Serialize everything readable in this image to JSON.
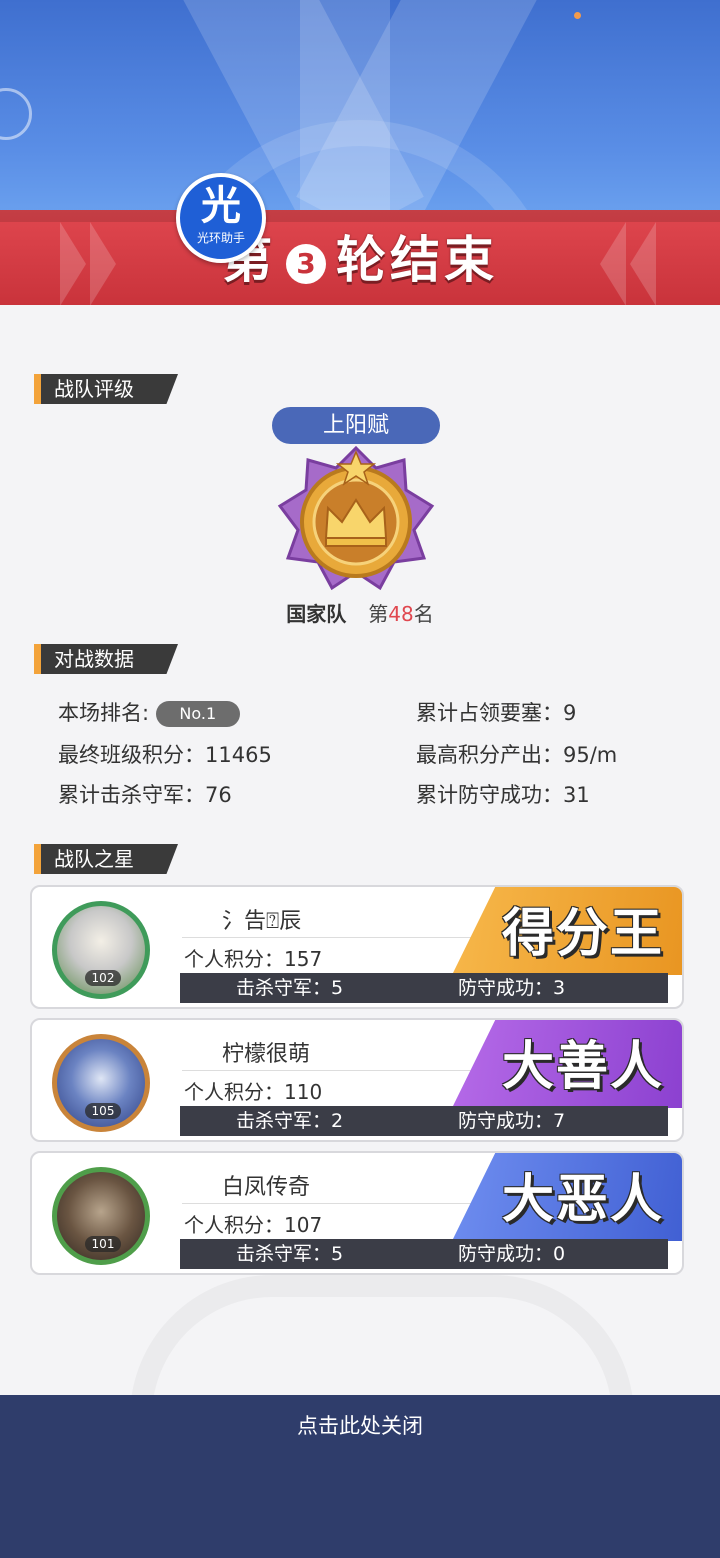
{
  "header": {
    "title_prefix": "第",
    "round_number": "3",
    "title_suffix": "轮结束",
    "logo_text": "光",
    "logo_subtext": "光环助手"
  },
  "team_rating": {
    "section_title": "战队评级",
    "rank_title": "上阳赋",
    "team_name": "国家队",
    "rank_prefix": "第",
    "rank_number": "48",
    "rank_suffix": "名"
  },
  "battle_data": {
    "section_title": "对战数据",
    "this_rank_label": "本场排名:",
    "this_rank_value": "No.1",
    "final_score": "最终班级积分：11465",
    "kills": "累计击杀守军：76",
    "fortresses": "累计占领要塞：9",
    "max_rate": "最高积分产出：95/m",
    "defenses": "累计防守成功：31"
  },
  "stars": {
    "section_title": "战队之星",
    "players": [
      {
        "name": "氵告⍰辰",
        "score": "个人积分：157",
        "kills": "击杀守军：5",
        "defense": "防守成功：3",
        "title": "得分王",
        "level": "102",
        "badge_color": "#f3a33a"
      },
      {
        "name": "柠檬很萌",
        "score": "个人积分：110",
        "kills": "击杀守军：2",
        "defense": "防守成功：7",
        "title": "大善人",
        "level": "105",
        "badge_color": "#9a4fd9"
      },
      {
        "name": "白凤传奇",
        "score": "个人积分：107",
        "kills": "击杀守军：5",
        "defense": "防守成功：0",
        "title": "大恶人",
        "level": "101",
        "badge_color": "#4f6fdc"
      }
    ]
  },
  "footer": {
    "close_label": "点击此处关闭"
  }
}
